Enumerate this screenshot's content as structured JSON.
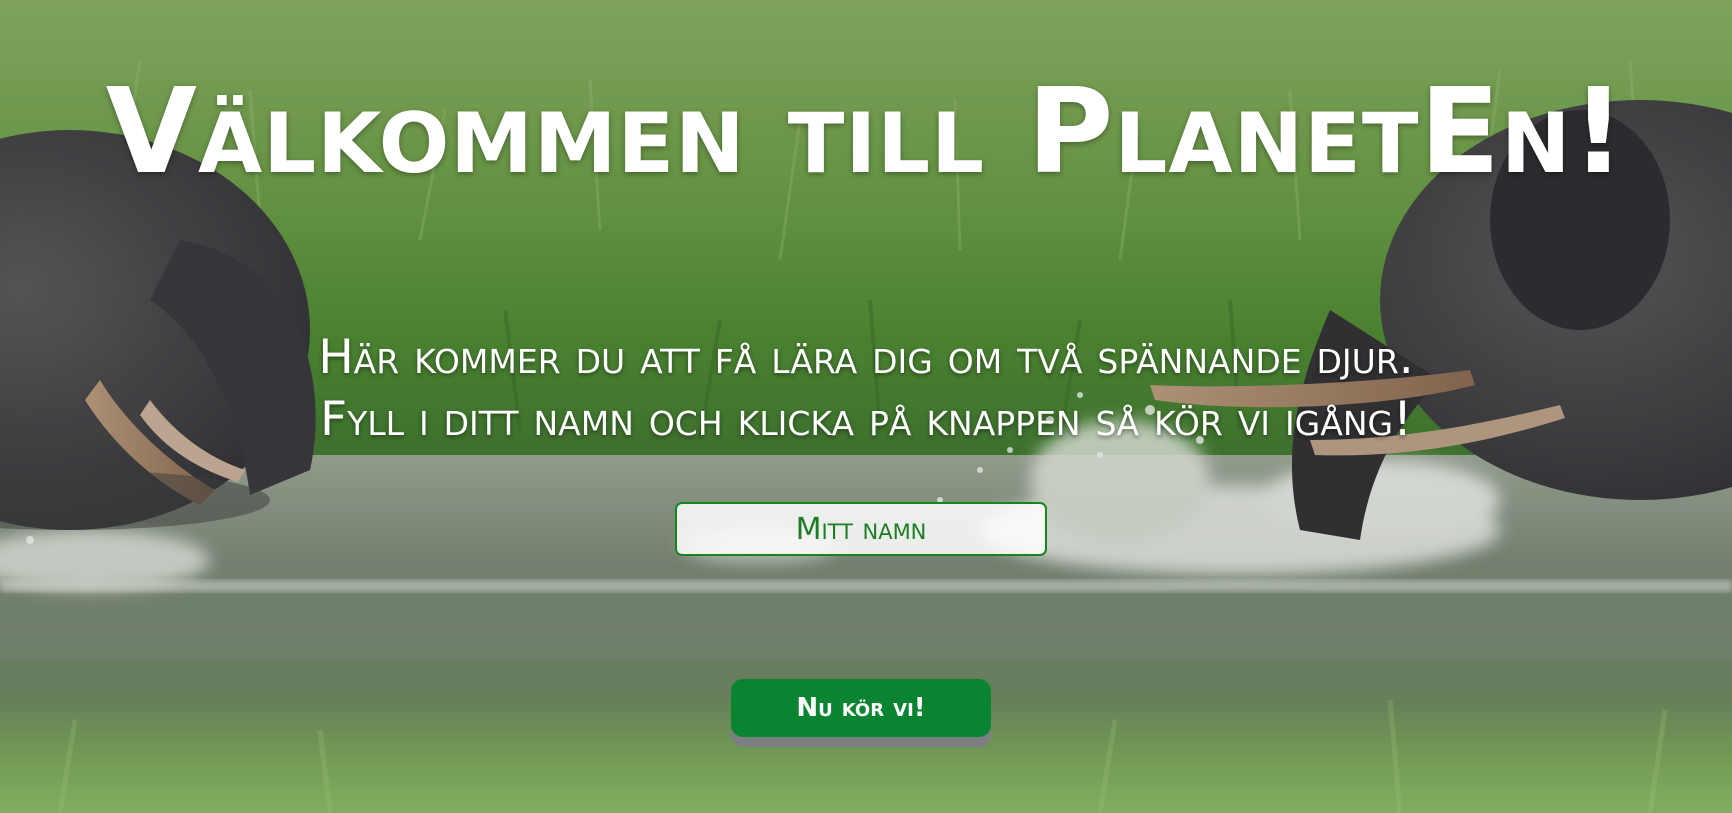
{
  "page": {
    "title": "Välkommen till PlanetEn!",
    "intro_line_1": "Här kommer du att få lära dig om två spännande djur.",
    "intro_line_2": "Fyll i ditt namn och klicka på knappen så kör vi igång!"
  },
  "form": {
    "name_placeholder": "Mitt namn",
    "name_value": "",
    "submit_label": "Nu kör vi!"
  },
  "background": {
    "subject": "elephants-in-water-photo"
  },
  "colors": {
    "accent_green": "#0a8430",
    "input_border": "#16851f",
    "text_white": "#ffffff"
  }
}
